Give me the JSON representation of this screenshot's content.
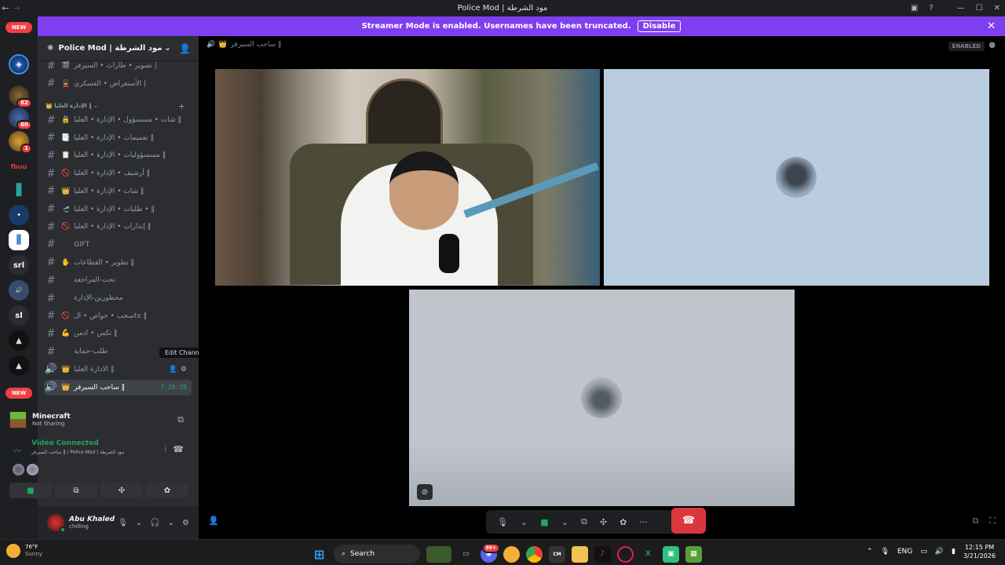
{
  "window": {
    "title": "Police Mod | مود الشرطة"
  },
  "guilds": {
    "new_label": "NEW",
    "badges": [
      "62",
      "60",
      "1"
    ],
    "texts": [
      "srl",
      "sl"
    ]
  },
  "banner": {
    "text": "Streamer Mode is enabled. Usernames have been truncated.",
    "disable_label": "Disable"
  },
  "server": {
    "name": "Police Mod | مود الشرطة"
  },
  "channels_top": [
    {
      "emoji": "🎬",
      "name": "تصوير • طارات • السيرفر |"
    },
    {
      "emoji": "💂",
      "name": "الأستعراض • العسكري |"
    }
  ],
  "category": {
    "name": "الإدارة العليا ‖"
  },
  "channels": [
    {
      "emoji": "🔒",
      "name": "شات • مسسؤول • الإدارة • العليا ‖"
    },
    {
      "emoji": "📑",
      "name": "تعميمات • الإدارة • العليا ‖"
    },
    {
      "emoji": "📋",
      "name": "مسسؤوليات • الإدارة • العليا ‖"
    },
    {
      "emoji": "🚫",
      "name": "أرشيف • الإدارة • العليا ‖"
    },
    {
      "emoji": "👑",
      "name": "شات • الإدارة • العليا ‖"
    },
    {
      "emoji": "🛫",
      "name": "طلبات • الإدارة • العليا • ‖"
    },
    {
      "emoji": "🚫",
      "name": "إنذارات • الإدارة • العليا ‖"
    },
    {
      "emoji": "",
      "name": "GIFT"
    },
    {
      "emoji": "✋",
      "name": "تطوير • القطاعات ‖"
    },
    {
      "emoji": "",
      "name": "تحت-المراجعة"
    },
    {
      "emoji": "",
      "name": "محظورين-الإدارة"
    },
    {
      "emoji": "🚫",
      "name": "سحب • خواص • الtx ‖"
    },
    {
      "emoji": "💪",
      "name": "تكس • ادمن ‖"
    },
    {
      "emoji": "",
      "name": "طلب-حماية"
    }
  ],
  "voice_channels": [
    {
      "name": "الادارة العليا ‖"
    },
    {
      "name": "ساحب السيرفر ‖",
      "timer": "7:28:38"
    }
  ],
  "tooltip": "Edit Channel",
  "activity": {
    "title": "Minecraft",
    "status": "Not Sharing"
  },
  "voice": {
    "status": "Video Connected",
    "location": "ساحب السيرفر ‖ / Police Mod | مود الشرطة"
  },
  "user": {
    "name": "Abu Khaled",
    "status": "chilling"
  },
  "stage": {
    "channel": "ساحب السيرفر ‖",
    "enabled_label": "ENABLED"
  },
  "taskbar": {
    "temp": "76°F",
    "weather": "Sunny",
    "search_placeholder": "Search",
    "lang": "ENG",
    "time": "12:15 PM",
    "date": "3/21/2026",
    "notif": "99+"
  }
}
